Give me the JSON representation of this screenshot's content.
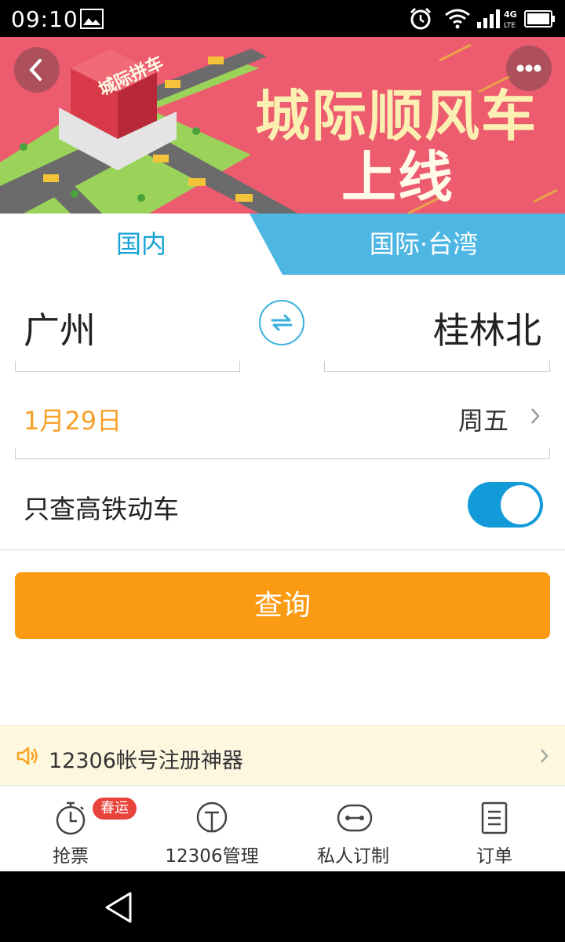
{
  "status_bar": {
    "time": "09:10",
    "network": "4G LTE",
    "icons": [
      "image-icon",
      "alarm-icon",
      "wifi-icon",
      "signal-icon",
      "battery-icon"
    ]
  },
  "banner": {
    "title_line1": "城际顺风车",
    "title_line2": "上线",
    "building_sign": "城际拼车",
    "colors": {
      "background": "#ec5b6e",
      "title": "#fbf0b2"
    },
    "page_count": 3,
    "active_page": 2
  },
  "tabs": [
    {
      "label": "国内",
      "active": true
    },
    {
      "label": "国际·台湾",
      "active": false
    }
  ],
  "route": {
    "from": "广州",
    "to": "桂林北"
  },
  "date": {
    "value": "1月29日",
    "weekday": "周五"
  },
  "filter": {
    "label": "只查高铁动车",
    "enabled": true
  },
  "search": {
    "label": "查询"
  },
  "notice": {
    "text": "12306帐号注册神器"
  },
  "bottom_nav": [
    {
      "label": "抢票",
      "icon": "stopwatch-icon",
      "badge": "春运"
    },
    {
      "label": "12306管理",
      "icon": "train-icon"
    },
    {
      "label": "私人订制",
      "icon": "robot-icon"
    },
    {
      "label": "订单",
      "icon": "order-list-icon"
    }
  ],
  "colors": {
    "accent_blue": "#18a3d5",
    "orange": "#fb9b14",
    "date_orange": "#f7a02a",
    "badge_red": "#e8433b"
  }
}
